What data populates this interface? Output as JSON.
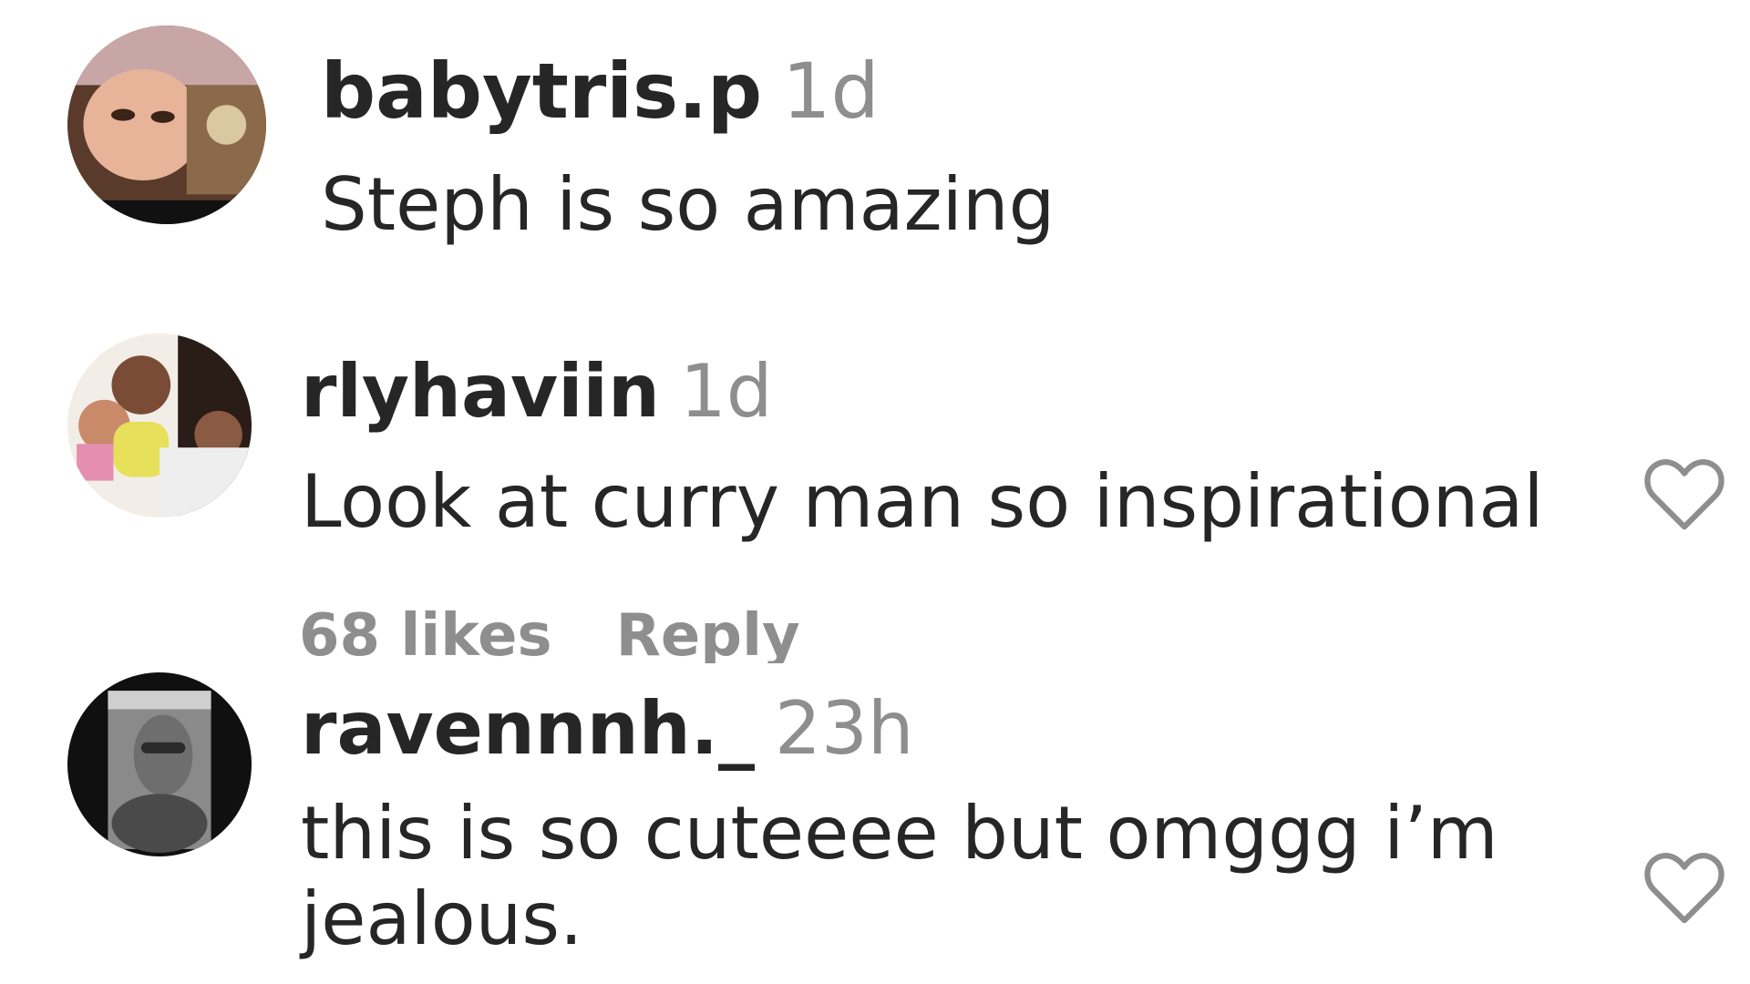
{
  "comments": [
    {
      "username": "babytris.p",
      "time": "1d",
      "text": "Steph is so amazing",
      "avatar_icon": "avatar-photo-icon",
      "avatar_colors": {
        "bg": "#5a3a2a",
        "face": "#e7b49a",
        "accent": "#f2d6d6"
      }
    },
    {
      "username": "rlyhaviin",
      "time": "1d",
      "text": "Look at curry man so inspirational",
      "likes": "68 likes",
      "reply": "Reply",
      "avatar_icon": "avatar-photo-icon",
      "like_icon": "heart-outline-icon",
      "avatar_colors": {
        "bg": "#f3ede8",
        "face": "#7a4c36",
        "accent": "#e6e05a"
      }
    },
    {
      "username": "ravennnh._",
      "time": "23h",
      "text": "this is so cuteeee but omggg i’m jealous.",
      "avatar_icon": "avatar-photo-icon",
      "like_icon": "heart-outline-icon",
      "avatar_colors": {
        "bg": "#101010",
        "face": "#6e6e6e",
        "accent": "#cfcfcf"
      }
    }
  ],
  "colors": {
    "text": "#262626",
    "secondary": "#8e8e8e",
    "heart": "#8e8e8e",
    "background": "#ffffff"
  }
}
